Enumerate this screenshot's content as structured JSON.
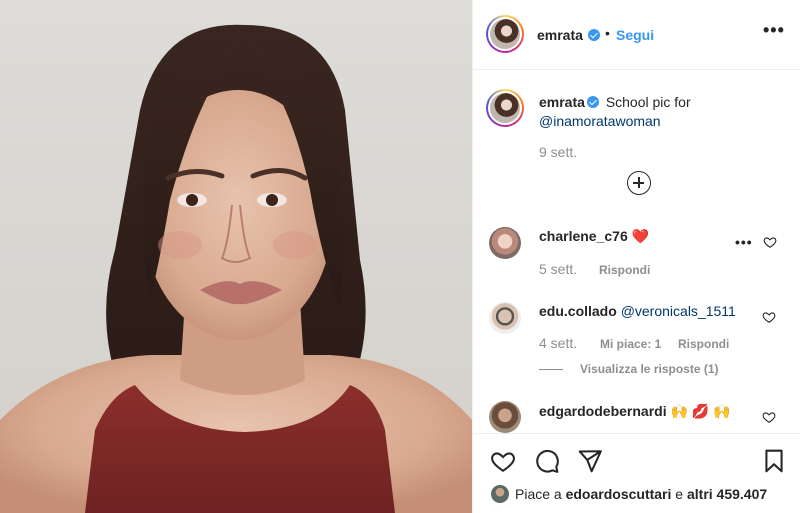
{
  "post": {
    "author": "emrata",
    "follow_label": "Segui",
    "separator": "•",
    "more_label": "•••"
  },
  "caption": {
    "username": "emrata",
    "text": "School pic for",
    "mention": "@inamoratawoman",
    "time": "9 sett."
  },
  "comments": [
    {
      "username": "charlene_c76",
      "text": "❤️",
      "time": "5 sett.",
      "reply_label": "Rispondi"
    },
    {
      "username": "edu.collado",
      "mention": "@veronicals_1511",
      "time": "4 sett.",
      "likes_label": "Mi piace: 1",
      "reply_label": "Rispondi",
      "view_replies_label": "Visualizza le risposte (1)"
    },
    {
      "username": "edgardodebernardi",
      "text": "🙌 💋 🙌"
    }
  ],
  "likes": {
    "prefix": "Piace a",
    "user": "edoardoscuttari",
    "conjunction": "e",
    "others": "altri 459.407"
  },
  "icons": {
    "like": "heart-icon",
    "comment": "comment-icon",
    "share": "share-icon",
    "save": "bookmark-icon",
    "add": "plus-circle-icon",
    "verified": "verified-badge-icon"
  },
  "colors": {
    "accent": "#3897f0",
    "mention": "#00376b",
    "muted": "#8e8e8e"
  }
}
